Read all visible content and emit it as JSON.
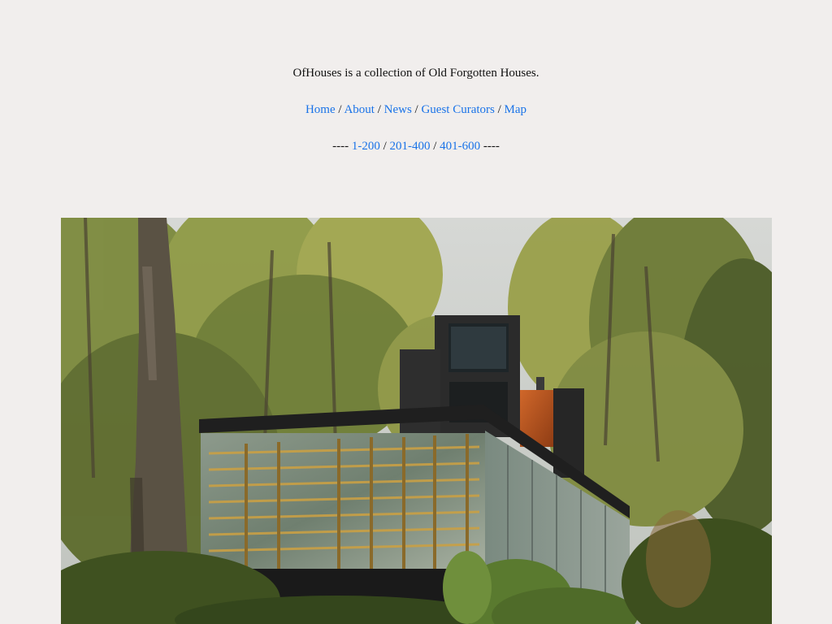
{
  "site": {
    "tagline": "OfHouses is a collection of Old Forgotten Houses."
  },
  "nav": {
    "items": [
      {
        "label": "Home"
      },
      {
        "label": "About"
      },
      {
        "label": "News"
      },
      {
        "label": "Guest Curators"
      },
      {
        "label": "Map"
      }
    ],
    "separator": "/"
  },
  "ranges": {
    "prefix": "----",
    "suffix": "----",
    "items": [
      {
        "label": "1-200"
      },
      {
        "label": "201-400"
      },
      {
        "label": "401-600"
      }
    ],
    "separator": "/"
  },
  "colors": {
    "background": "#f1eeed",
    "link": "#1a73e8",
    "text": "#111111"
  }
}
